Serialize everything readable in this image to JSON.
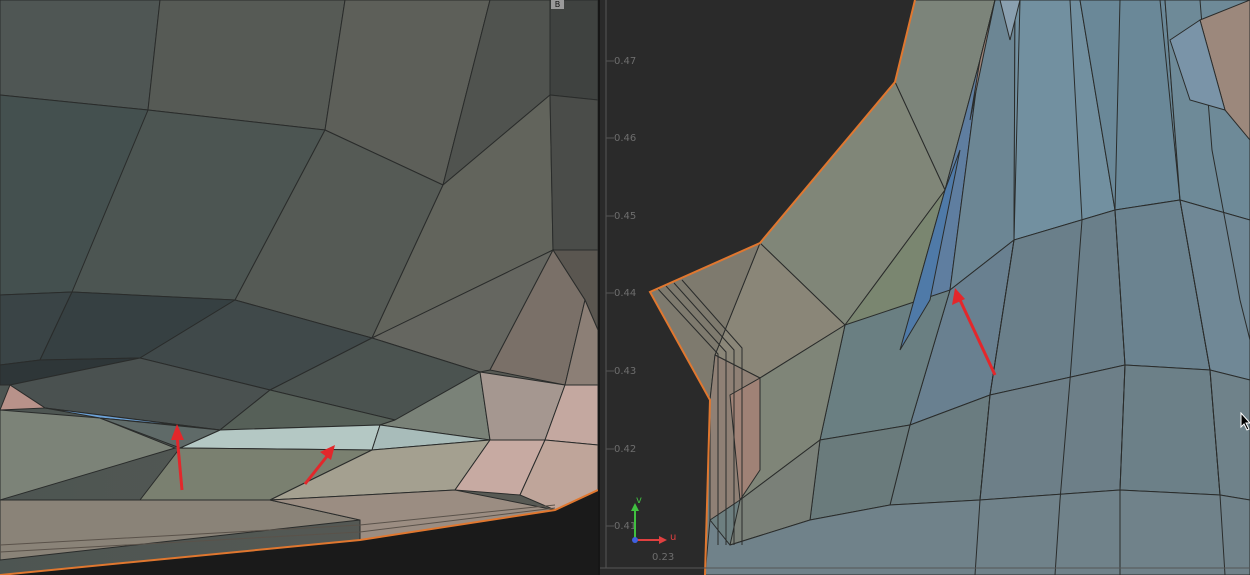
{
  "viewport_3d": {
    "corner_label": "B"
  },
  "uv_editor": {
    "v_ticks": [
      "0.47",
      "0.46",
      "0.45",
      "0.44",
      "0.43",
      "0.42",
      "0.41"
    ],
    "u_tick": "0.23",
    "axis_u_label": "u",
    "axis_v_label": "v"
  },
  "colors": {
    "annotation_arrow": "#e3272b",
    "selection_edge": "#e0772f",
    "axis_u": "#e04040",
    "axis_v": "#40c040",
    "uv_background": "#2a2a2a"
  }
}
